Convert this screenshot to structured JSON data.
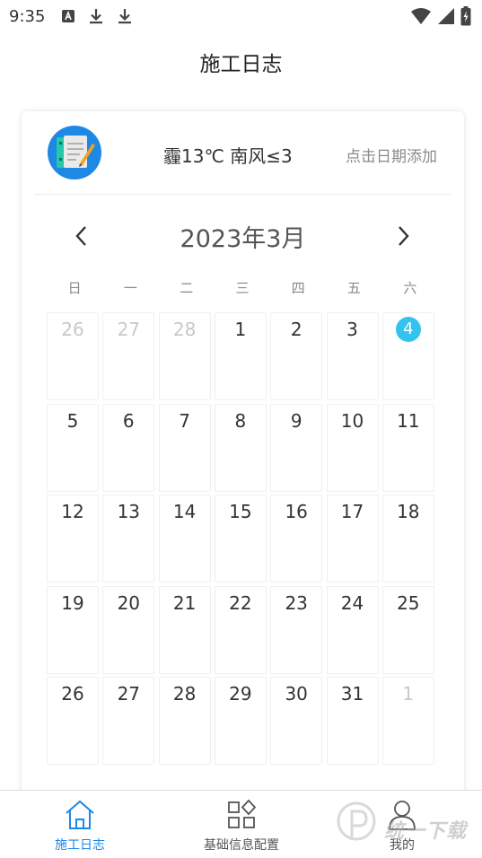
{
  "status_bar": {
    "time": "9:35"
  },
  "app": {
    "title": "施工日志"
  },
  "card": {
    "weather": "霾13℃ 南风≤3",
    "add_hint": "点击日期添加",
    "month_label": "2023年3月",
    "weekdays": [
      "日",
      "一",
      "二",
      "三",
      "四",
      "五",
      "六"
    ],
    "weeks": [
      [
        {
          "d": "26",
          "other": true
        },
        {
          "d": "27",
          "other": true
        },
        {
          "d": "28",
          "other": true
        },
        {
          "d": "1"
        },
        {
          "d": "2"
        },
        {
          "d": "3"
        },
        {
          "d": "4",
          "today": true
        }
      ],
      [
        {
          "d": "5"
        },
        {
          "d": "6"
        },
        {
          "d": "7"
        },
        {
          "d": "8"
        },
        {
          "d": "9"
        },
        {
          "d": "10"
        },
        {
          "d": "11"
        }
      ],
      [
        {
          "d": "12"
        },
        {
          "d": "13"
        },
        {
          "d": "14"
        },
        {
          "d": "15"
        },
        {
          "d": "16"
        },
        {
          "d": "17"
        },
        {
          "d": "18"
        }
      ],
      [
        {
          "d": "19"
        },
        {
          "d": "20"
        },
        {
          "d": "21"
        },
        {
          "d": "22"
        },
        {
          "d": "23"
        },
        {
          "d": "24"
        },
        {
          "d": "25"
        }
      ],
      [
        {
          "d": "26"
        },
        {
          "d": "27"
        },
        {
          "d": "28"
        },
        {
          "d": "29"
        },
        {
          "d": "30"
        },
        {
          "d": "31"
        },
        {
          "d": "1",
          "other": true
        }
      ]
    ]
  },
  "bottom_nav": {
    "items": [
      {
        "label": "施工日志",
        "icon": "home-icon",
        "active": true
      },
      {
        "label": "基础信息配置",
        "icon": "grid-icon",
        "active": false
      },
      {
        "label": "我的",
        "icon": "user-icon",
        "active": false
      }
    ]
  },
  "colors": {
    "accent": "#1e88e5",
    "today": "#33c3ef"
  },
  "watermark": {
    "text": "统一下载"
  }
}
